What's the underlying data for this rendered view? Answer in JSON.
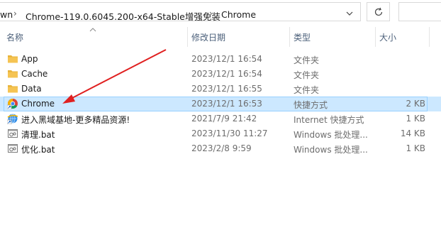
{
  "address_bar": {
    "breadcrumb_partial": "wn",
    "breadcrumb_folder": "Chrome-119.0.6045.200-x64-Stable增强免装",
    "breadcrumb_current": "Chrome",
    "separator_glyph": "›",
    "dropdown_icon": "chevron-down-icon",
    "refresh_icon": "refresh-icon"
  },
  "columns": {
    "name": "名称",
    "date": "修改日期",
    "type": "类型",
    "size": "大小"
  },
  "files": [
    {
      "name": "App",
      "date": "2023/12/1 16:54",
      "type": "文件夹",
      "size": "",
      "icon": "folder-icon",
      "selected": false
    },
    {
      "name": "Cache",
      "date": "2023/12/1 16:54",
      "type": "文件夹",
      "size": "",
      "icon": "folder-icon",
      "selected": false
    },
    {
      "name": "Data",
      "date": "2023/12/1 16:55",
      "type": "文件夹",
      "size": "",
      "icon": "folder-icon",
      "selected": false
    },
    {
      "name": "Chrome",
      "date": "2023/12/1 16:53",
      "type": "快捷方式",
      "size": "2 KB",
      "icon": "chrome-shortcut-icon",
      "selected": true
    },
    {
      "name": "进入黑域基地-更多精品资源!",
      "date": "2021/7/9 21:42",
      "type": "Internet 快捷方式",
      "size": "1 KB",
      "icon": "internet-shortcut-icon",
      "selected": false
    },
    {
      "name": "清理.bat",
      "date": "2023/11/30 11:27",
      "type": "Windows 批处理...",
      "size": "14 KB",
      "icon": "batch-file-icon",
      "selected": false
    },
    {
      "name": "优化.bat",
      "date": "2023/2/8 9:59",
      "type": "Windows 批处理...",
      "size": "1 KB",
      "icon": "batch-file-icon",
      "selected": false
    }
  ],
  "colors": {
    "selection_bg": "#cce8ff",
    "selection_border": "#99d1ff",
    "header_text": "#4c607a",
    "arrow": "#e02020",
    "folder": "#f5c453"
  }
}
